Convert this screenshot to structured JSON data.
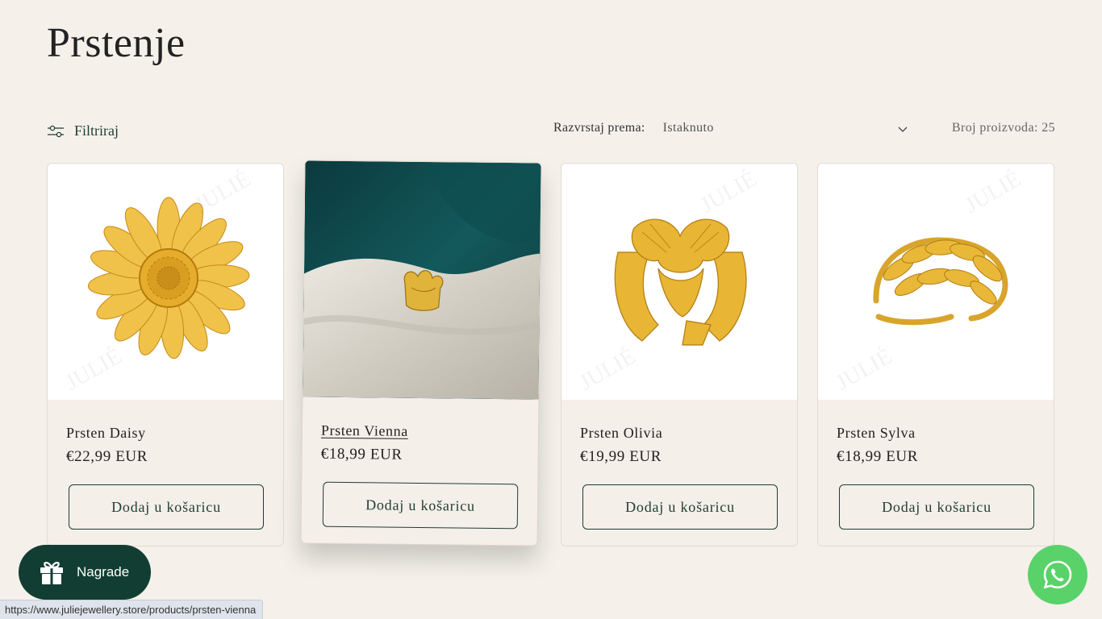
{
  "page": {
    "title": "Prstenje"
  },
  "toolbar": {
    "filter_label": "Filtriraj",
    "sort_label": "Razvrstaj prema:",
    "sort_value": "Istaknuto",
    "count_text": "Broj proizvoda: 25"
  },
  "products": [
    {
      "name": "Prsten Daisy",
      "price": "€22,99 EUR",
      "button": "Dodaj u košaricu"
    },
    {
      "name": "Prsten Vienna",
      "price": "€18,99 EUR",
      "button": "Dodaj u košaricu"
    },
    {
      "name": "Prsten Olivia",
      "price": "€19,99 EUR",
      "button": "Dodaj u košaricu"
    },
    {
      "name": "Prsten Sylva",
      "price": "€18,99 EUR",
      "button": "Dodaj u košaricu"
    }
  ],
  "rewards": {
    "label": "Nagrade"
  },
  "status_bar": {
    "url": "https://www.juliejewellery.store/products/prsten-vienna"
  },
  "colors": {
    "background": "#f5f1ea",
    "accent_dark_green": "#123d32",
    "whatsapp_green": "#59d26a",
    "gold": "#e0b43a"
  },
  "icons": {
    "filter": "sliders-icon",
    "sort": "chevron-down-icon",
    "rewards": "gift-icon",
    "chat": "whatsapp-icon"
  }
}
